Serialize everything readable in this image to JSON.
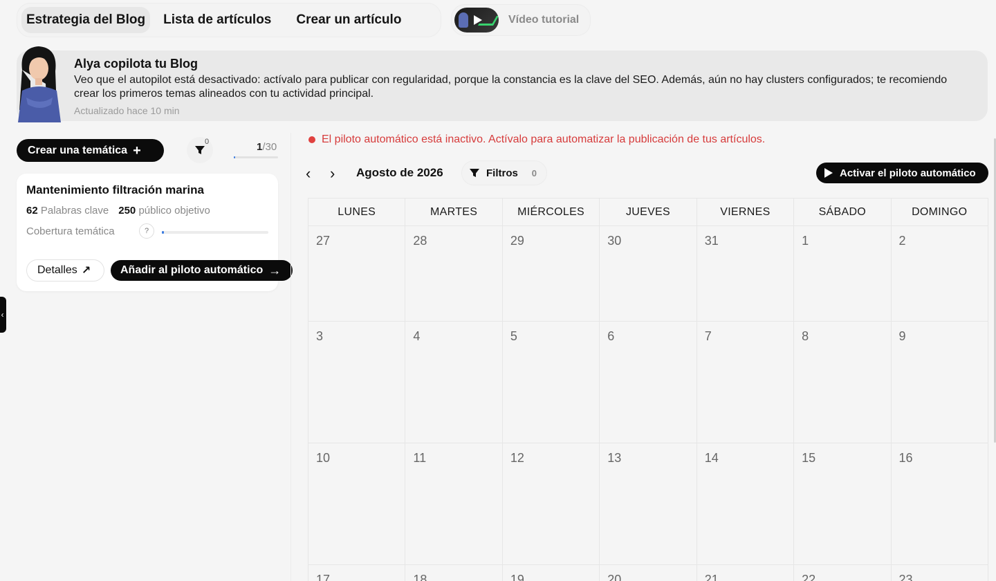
{
  "tabs": [
    {
      "label": "Estrategia del Blog",
      "active": true
    },
    {
      "label": "Lista de artículos",
      "active": false
    },
    {
      "label": "Crear un artículo",
      "active": false
    }
  ],
  "video": {
    "label": "Vídeo tutorial",
    "thumb_icon": "play-icon"
  },
  "banner": {
    "title": "Alya copilota tu Blog",
    "text": "Veo que el autopilot está desactivado: actívalo para publicar con regularidad, porque la constancia es la clave del SEO. Además, aún no hay clusters configurados; te recomiendo crear los primeros temas alineados con tu actividad principal.",
    "updated": "Actualizado hace 10 min"
  },
  "left": {
    "create_label": "Crear una temática",
    "filter_count": "0",
    "counter_used": "1",
    "counter_total": "/30",
    "counter_progress": 0.033
  },
  "topic_card": {
    "title": "Mantenimiento filtración marina",
    "keywords_count": "62",
    "keywords_label": "Palabras clave",
    "audience_count": "250",
    "audience_label": "público objetivo",
    "coverage_label": "Cobertura temática",
    "help": "?",
    "coverage_progress": 0.01,
    "details_label": "Detalles",
    "add_label": "Añadir al piloto automático"
  },
  "alert": {
    "text": "El piloto automático está inactivo. Actívalo para automatizar la publicación de tus artículos.",
    "color": "#d63b3b"
  },
  "calendar_bar": {
    "month": "Agosto de 2026",
    "filters_label": "Filtros",
    "filters_count": "0",
    "autopilot_label": "Activar el piloto automático"
  },
  "calendar": {
    "weekdays": [
      "LUNES",
      "MARTES",
      "MIÉRCOLES",
      "JUEVES",
      "VIERNES",
      "SÁBADO",
      "DOMINGO"
    ],
    "weeks": [
      [
        "27",
        "28",
        "29",
        "30",
        "31",
        "1",
        "2"
      ],
      [
        "3",
        "4",
        "5",
        "6",
        "7",
        "8",
        "9"
      ],
      [
        "10",
        "11",
        "12",
        "13",
        "14",
        "15",
        "16"
      ],
      [
        "17",
        "18",
        "19",
        "20",
        "21",
        "22",
        "23"
      ]
    ]
  },
  "colors": {
    "accent": "#0b0b0b",
    "alert": "#e0413f",
    "progress": "#3a7be0"
  }
}
